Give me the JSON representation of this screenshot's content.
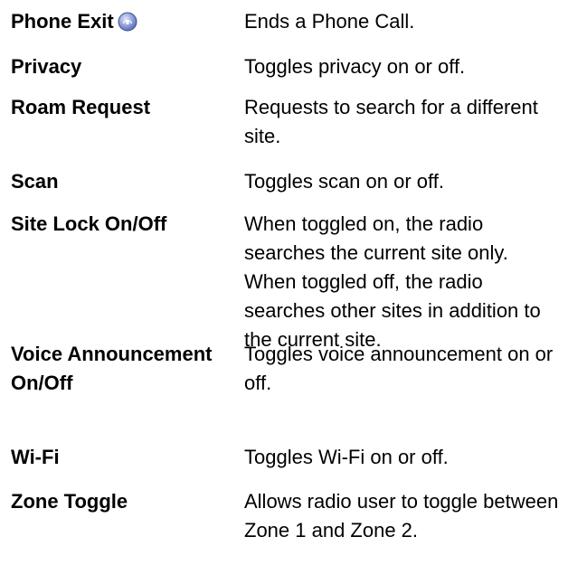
{
  "rows": [
    {
      "term": "Phone Exit",
      "icon": "phone-exit-icon",
      "description": "Ends a Phone Call."
    },
    {
      "term": "Privacy",
      "description": "Toggles privacy on or off."
    },
    {
      "term": "Roam Request",
      "description": "Requests to search for a different site."
    },
    {
      "term": "Scan",
      "description": "Toggles scan on or off."
    },
    {
      "term": "Site Lock On/Off",
      "description": "When toggled on, the radio searches the current site only. When toggled off, the radio searches other sites in addition to the current site."
    },
    {
      "term": "Voice Announcement On/Off",
      "description": "Toggles voice announcement on or off."
    },
    {
      "term": "Wi-Fi",
      "description": "Toggles Wi-Fi on or off."
    },
    {
      "term": "Zone Toggle",
      "description": "Allows radio user to toggle between Zone 1 and Zone 2."
    }
  ],
  "colors": {
    "text": "#000000",
    "icon_fill": "#5b6fb8",
    "icon_highlight": "#dfe6ff"
  }
}
